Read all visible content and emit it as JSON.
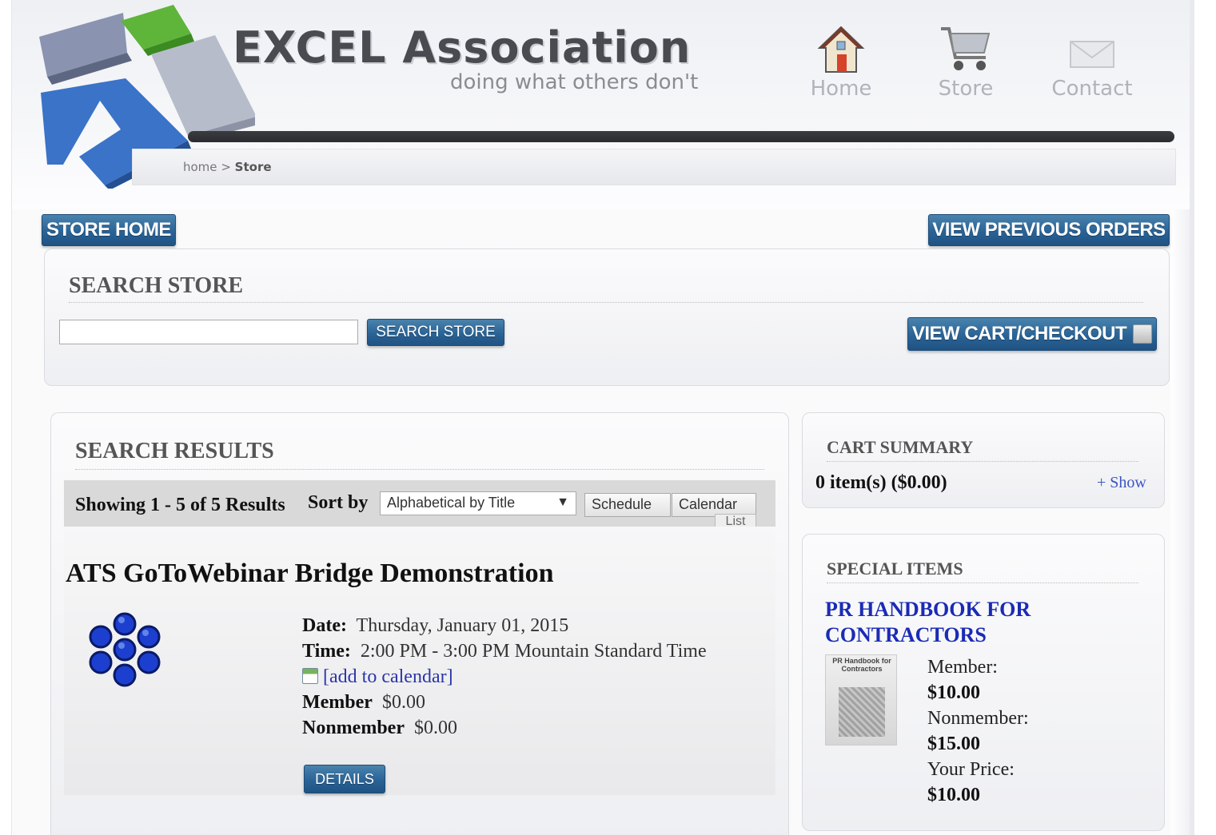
{
  "header": {
    "brand": "EXCEL Association",
    "tagline": "doing what others don't",
    "nav": [
      {
        "label": "Home",
        "icon": "home-icon"
      },
      {
        "label": "Store",
        "icon": "cart-icon"
      },
      {
        "label": "Contact",
        "icon": "envelope-icon"
      }
    ],
    "breadcrumb": {
      "home": "home",
      "separator": ">",
      "current": "Store"
    }
  },
  "buttons": {
    "store_home": "STORE HOME",
    "view_previous_orders": "VIEW PREVIOUS ORDERS",
    "search_store": "SEARCH STORE",
    "view_cart_checkout": "VIEW CART/CHECKOUT",
    "details": "DETAILS"
  },
  "search": {
    "title": "SEARCH STORE",
    "value": ""
  },
  "results": {
    "title": "SEARCH RESULTS",
    "showing": "Showing 1 - 5 of 5 Results",
    "sort_label": "Sort by",
    "sort_selected": "Alphabetical by Title",
    "views": {
      "schedule": "Schedule",
      "calendar": "Calendar",
      "list": "List"
    },
    "product": {
      "title": "ATS GoToWebinar Bridge Demonstration",
      "date_label": "Date:",
      "date": "Thursday, January 01, 2015",
      "time_label": "Time:",
      "time": "2:00 PM - 3:00 PM Mountain Standard Time",
      "add_to_calendar": "[add to calendar]",
      "member_label": "Member",
      "member_price": "$0.00",
      "nonmember_label": "Nonmember",
      "nonmember_price": "$0.00"
    }
  },
  "cart": {
    "title": "CART SUMMARY",
    "count": "0 item(s) ($0.00)",
    "show": "+ Show"
  },
  "special": {
    "title": "SPECIAL ITEMS",
    "name": "PR HANDBOOK FOR CONTRACTORS",
    "cover_text": "PR Handbook for Contractors",
    "member_label": "Member:",
    "member_price": "$10.00",
    "nonmember_label": "Nonmember:",
    "nonmember_price": "$15.00",
    "your_price_label": "Your Price:",
    "your_price": "$10.00"
  },
  "colors": {
    "button_blue": "#2a6396",
    "link_blue": "#1b2bb5",
    "header_bar": "#2b2c30"
  }
}
